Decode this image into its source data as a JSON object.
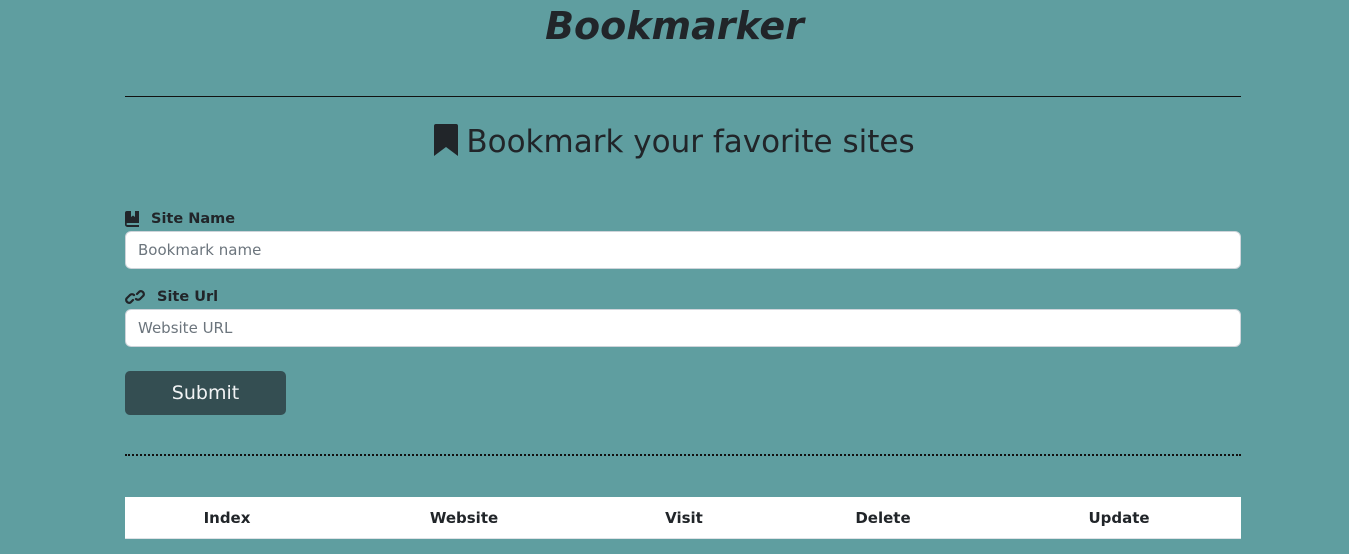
{
  "header": {
    "app_title": "Bookmarker"
  },
  "form": {
    "heading": "Bookmark your favorite sites",
    "heading_icon": "bookmark-icon",
    "site_name": {
      "label": "Site Name",
      "icon": "book-bookmark-icon",
      "placeholder": "Bookmark name",
      "value": ""
    },
    "site_url": {
      "label": "Site Url",
      "icon": "link-icon",
      "placeholder": "Website URL",
      "value": ""
    },
    "submit_label": "Submit"
  },
  "table": {
    "columns": [
      "Index",
      "Website",
      "Visit",
      "Delete",
      "Update"
    ],
    "rows": []
  },
  "colors": {
    "background": "#5f9ea0",
    "button": "#344e52",
    "text": "#212529"
  }
}
